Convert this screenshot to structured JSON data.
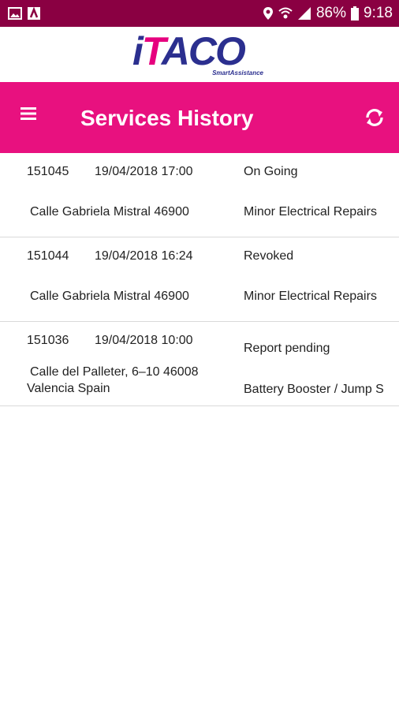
{
  "status_bar": {
    "battery": "86%",
    "time": "9:18",
    "icons": [
      "gallery-icon",
      "maps-icon",
      "location-icon",
      "wifi-icon",
      "signal-icon",
      "battery-icon"
    ]
  },
  "logo": {
    "brand": "iTACO",
    "tagline": "SmartAssistance"
  },
  "app_bar": {
    "title": "Services History",
    "menu_icon": "menu-icon",
    "refresh_icon": "refresh-icon",
    "colors": {
      "primary": "#e8117f",
      "status_bar": "#8a0042",
      "logo_blue": "#2b2f8f"
    }
  },
  "services": [
    {
      "id": "151045",
      "datetime": "19/04/2018 17:00",
      "status": "On Going",
      "address": "Calle Gabriela Mistral 46900",
      "service_type": "Minor Electrical Repairs"
    },
    {
      "id": "151044",
      "datetime": "19/04/2018 16:24",
      "status": "Revoked",
      "address": "Calle Gabriela Mistral 46900",
      "service_type": "Minor Electrical Repairs"
    },
    {
      "id": "151036",
      "datetime": "19/04/2018 10:00",
      "status": "Report pending",
      "address_line1": "Calle del Palleter, 6–10 46008",
      "address_line2": "Valencia Spain",
      "service_type": "Battery Booster / Jump S"
    }
  ]
}
